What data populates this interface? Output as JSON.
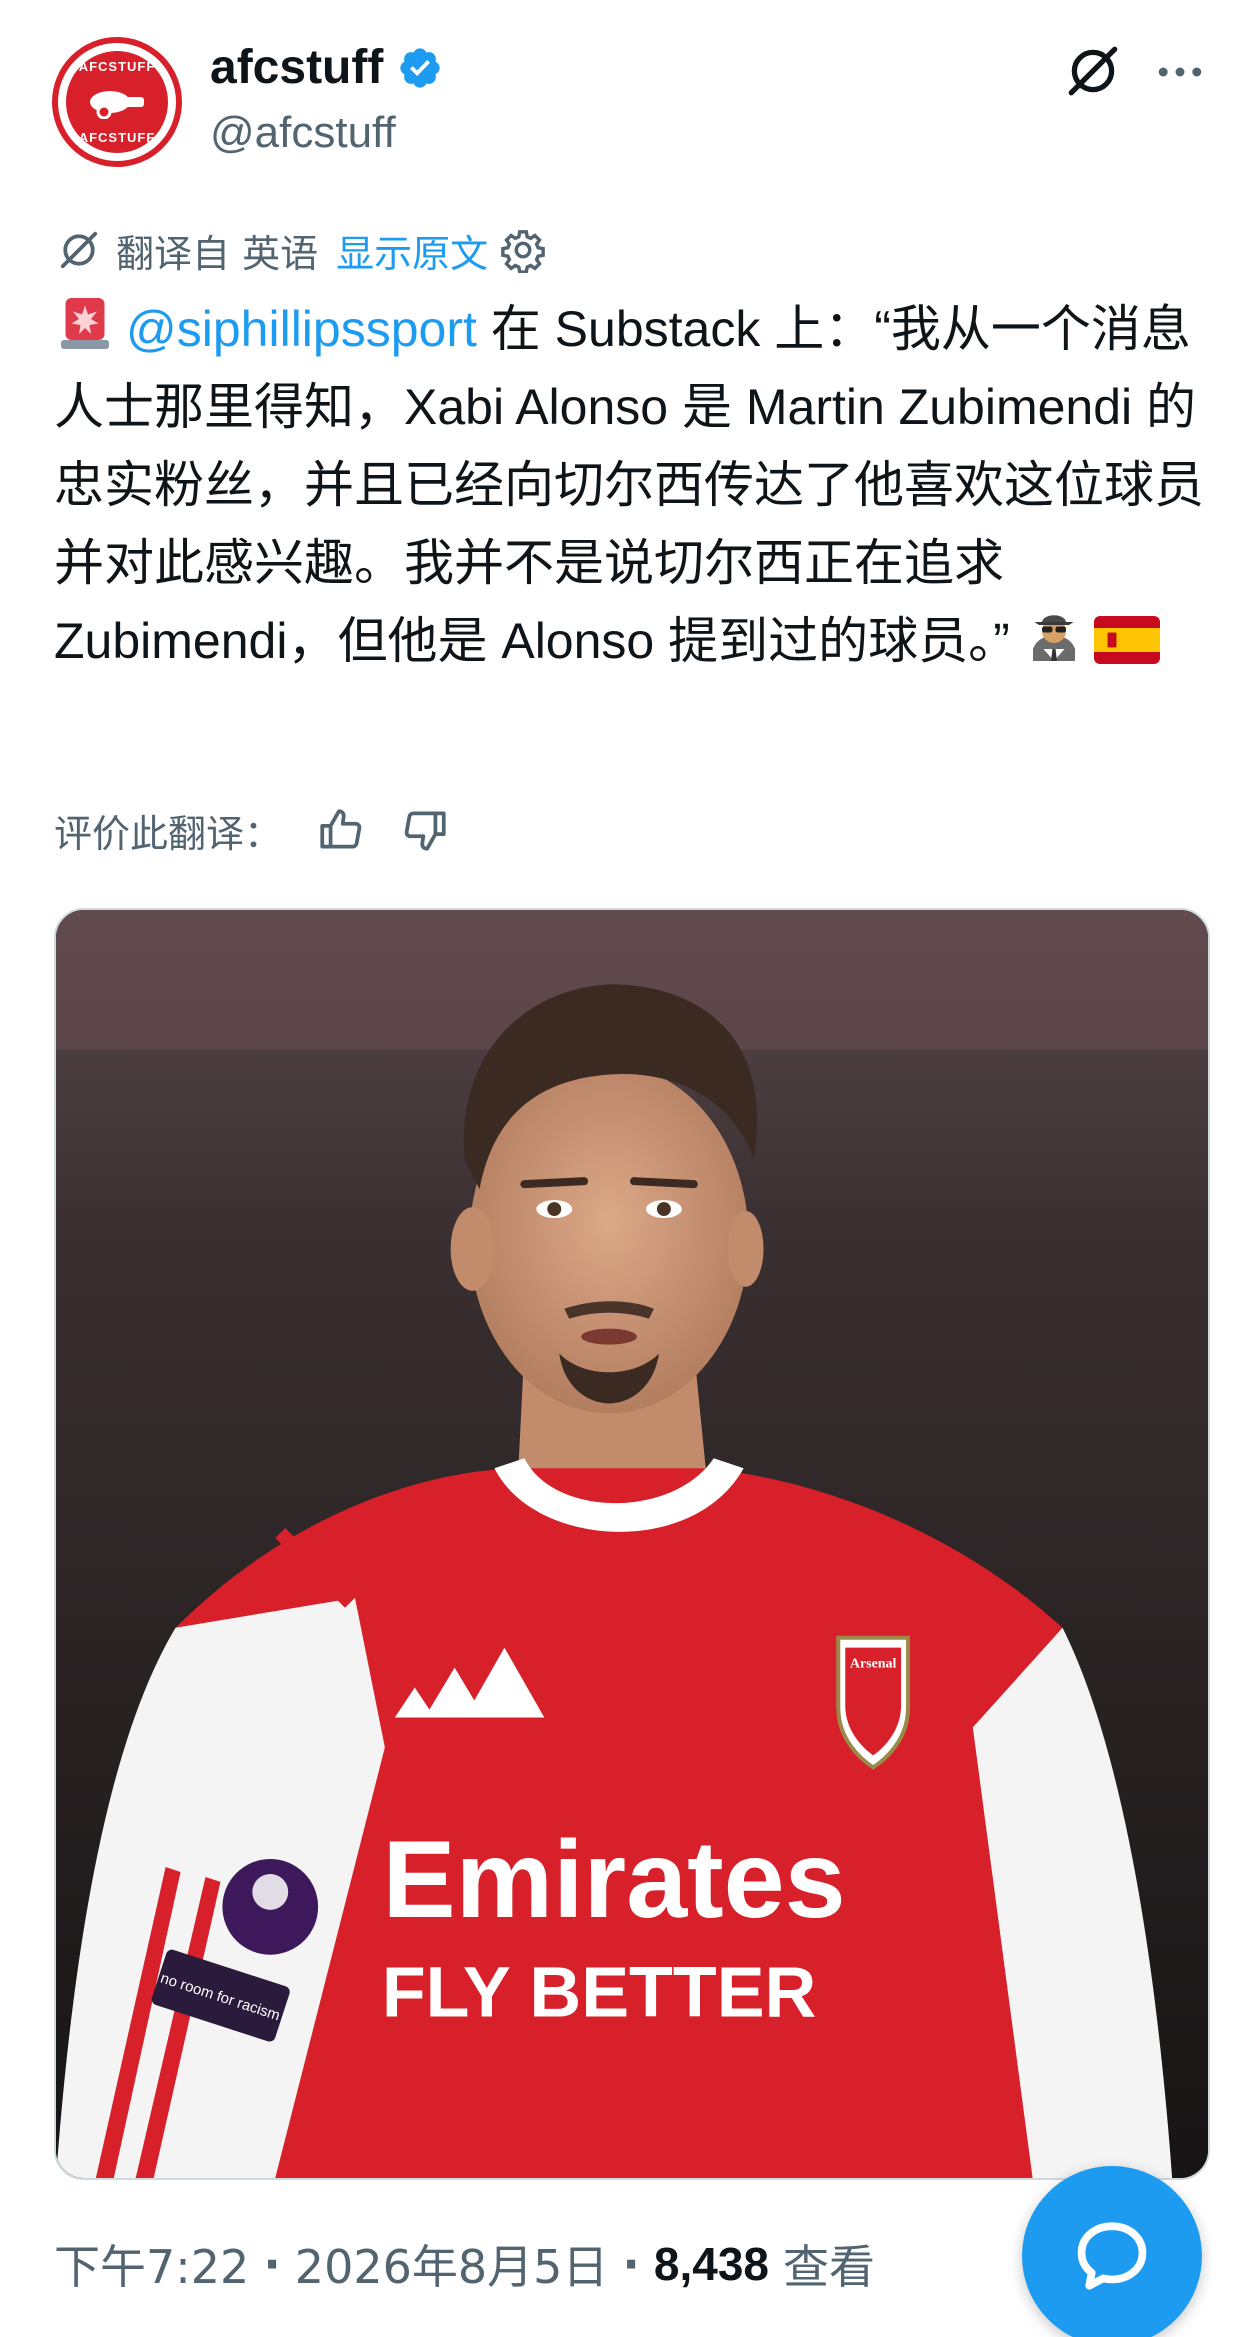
{
  "header": {
    "avatar_text": "AFCSTUFF",
    "display_name": "afcstuff",
    "handle": "@afcstuff"
  },
  "translation": {
    "notice": "翻译自 英语",
    "show_original": "显示原文"
  },
  "tweet": {
    "mention": "@siphillipssport",
    "body": " 在 Substack 上：“我从一个消息人士那里得知，Xabi Alonso 是 Martin Zubimendi 的忠实粉丝，并且已经向切尔西传达了他喜欢这位球员并对此感兴趣。我并不是说切尔西正在追求 Zubimendi，但他是 Alonso 提到过的球员。”"
  },
  "rate_translation": {
    "label": "评价此翻译："
  },
  "photo": {
    "shirt_sponsor_top": "Emirates",
    "shirt_sponsor_bottom": "FLY BETTER",
    "sleeve_patch": "no room for racism",
    "crest_text": "Arsenal"
  },
  "meta": {
    "time": "下午7:22",
    "separator": "·",
    "date": "2026年8月5日",
    "views_count": "8,438",
    "views_label": "查看"
  },
  "colors": {
    "accent": "#1d9bf0",
    "text_primary": "#0f1419",
    "text_secondary": "#536471",
    "arsenal_red": "#d8202a"
  },
  "icons": {
    "verified": "verified-badge-icon",
    "grok": "grok-icon",
    "more": "more-icon",
    "translate": "translate-icon",
    "settings": "gear-icon",
    "thumbs_up": "thumbs-up-icon",
    "thumbs_down": "thumbs-down-icon",
    "compose_reply": "chat-bubble-icon"
  }
}
